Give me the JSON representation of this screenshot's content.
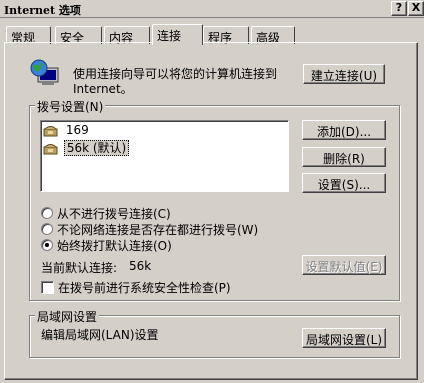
{
  "window": {
    "title": "Internet 选项",
    "help_label": "?",
    "close_label": "X"
  },
  "tabs": [
    {
      "label": "常规",
      "active": false
    },
    {
      "label": "安全",
      "active": false
    },
    {
      "label": "内容",
      "active": false
    },
    {
      "label": "连接",
      "active": true
    },
    {
      "label": "程序",
      "active": false
    },
    {
      "label": "高级",
      "active": false
    }
  ],
  "setup": {
    "text_line1": "使用连接向导可以将您的计算机连接到",
    "text_line2": "Internet。",
    "button_label": "建立连接(U)"
  },
  "dialup": {
    "group_title": "拨号设置(N)",
    "connections": [
      {
        "name": "169",
        "selected": false
      },
      {
        "name": "56k (默认)",
        "selected": true
      }
    ],
    "add_label": "添加(D)...",
    "delete_label": "删除(R)",
    "settings_label": "设置(S)...",
    "options": [
      {
        "label": "从不进行拨号连接(C)",
        "checked": false
      },
      {
        "label": "不论网络连接是否存在都进行拨号(W)",
        "checked": false
      },
      {
        "label": "始终拨打默认连接(O)",
        "checked": true
      }
    ],
    "current_default_label": "当前默认连接:",
    "current_default_value": "56k",
    "set_default_label": "设置默认值(E)",
    "security_check_label": "在拨号前进行系统安全性检查(P)",
    "security_check_checked": false
  },
  "lan": {
    "group_title": "局域网设置",
    "description": "编辑局域网(LAN)设置",
    "button_label": "局域网设置(L)"
  },
  "colors": {
    "face": "#d4d0c8",
    "highlight": "#ffffff",
    "shadow": "#808080",
    "dark_shadow": "#404040"
  }
}
